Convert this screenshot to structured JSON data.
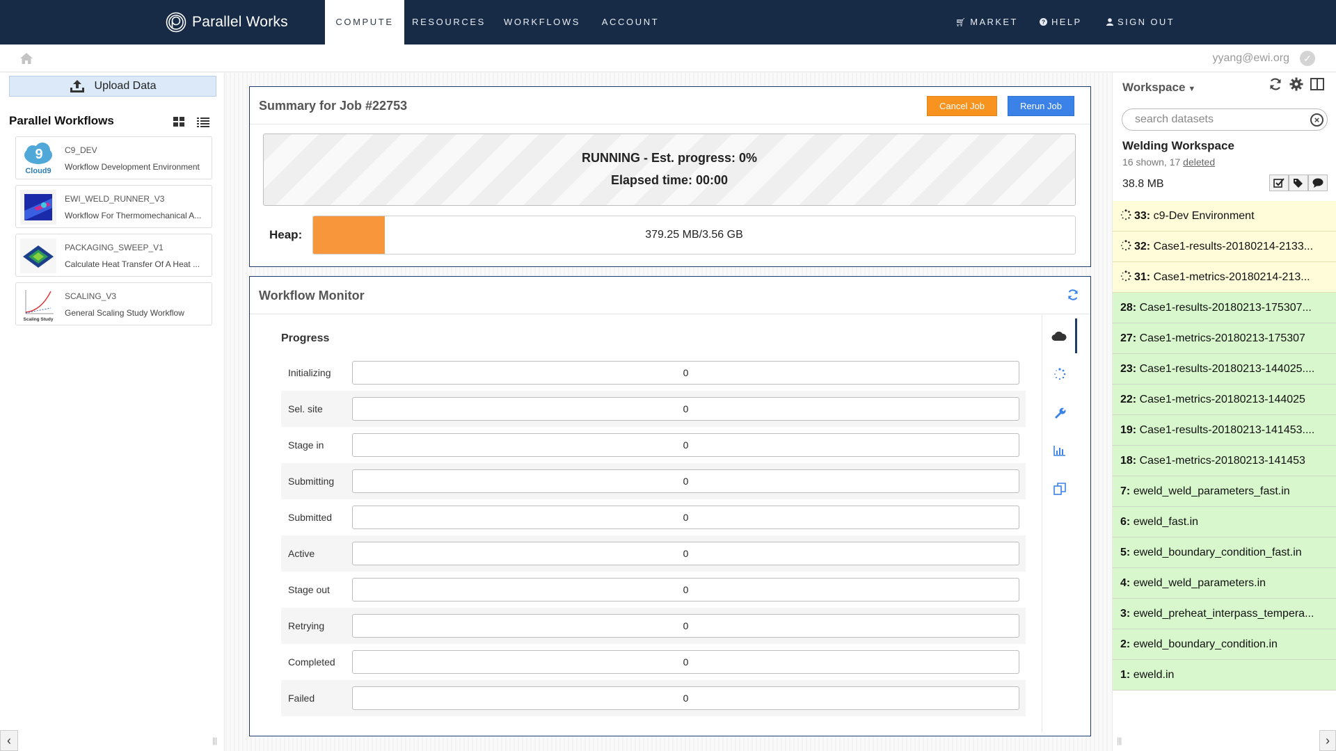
{
  "brand": {
    "name": "Parallel Works"
  },
  "nav": {
    "tabs": [
      {
        "label": "COMPUTE",
        "active": true
      },
      {
        "label": "RESOURCES",
        "active": false
      },
      {
        "label": "WORKFLOWS",
        "active": false
      },
      {
        "label": "ACCOUNT",
        "active": false
      }
    ],
    "right": [
      {
        "label": "MARKET",
        "icon": "cart-icon"
      },
      {
        "label": "HELP",
        "icon": "question-circle-icon"
      },
      {
        "label": "SIGN OUT",
        "icon": "user-icon"
      }
    ]
  },
  "user": {
    "email": "yyang@ewi.org"
  },
  "left": {
    "upload_label": "Upload Data",
    "title": "Parallel Workflows",
    "workflows": [
      {
        "name": "C9_DEV",
        "description": "Workflow Development Environment"
      },
      {
        "name": "EWI_WELD_RUNNER_V3",
        "description": "Workflow For Thermomechanical A..."
      },
      {
        "name": "PACKAGING_SWEEP_V1",
        "description": "Calculate Heat Transfer Of A Heat ..."
      },
      {
        "name": "SCALING_V3",
        "description": "General Scaling Study Workflow"
      }
    ],
    "thumb_texts": {
      "cloud9": "Cloud9",
      "scaling": "Scaling Study"
    }
  },
  "summary": {
    "title": "Summary for Job #22753",
    "cancel_label": "Cancel Job",
    "rerun_label": "Rerun Job",
    "status": "RUNNING - Est. progress: 0%",
    "elapsed": "Elapsed time: 00:00",
    "heap_label": "Heap:",
    "heap_text": "379.25 MB/3.56 GB",
    "heap_fraction": 0.094
  },
  "monitor": {
    "title": "Workflow Monitor",
    "progress_title": "Progress",
    "rows": [
      {
        "label": "Initializing",
        "value": "0"
      },
      {
        "label": "Sel. site",
        "value": "0"
      },
      {
        "label": "Stage in",
        "value": "0"
      },
      {
        "label": "Submitting",
        "value": "0"
      },
      {
        "label": "Submitted",
        "value": "0"
      },
      {
        "label": "Active",
        "value": "0"
      },
      {
        "label": "Stage out",
        "value": "0"
      },
      {
        "label": "Retrying",
        "value": "0"
      },
      {
        "label": "Completed",
        "value": "0"
      },
      {
        "label": "Failed",
        "value": "0"
      }
    ],
    "side_tabs": [
      "cloud-icon",
      "spinner-icon",
      "wrench-icon",
      "bar-chart-icon",
      "copy-icon"
    ]
  },
  "workspace": {
    "title": "Workspace",
    "search_placeholder": "search datasets",
    "name": "Welding Workspace",
    "count_prefix": "16 shown, 17 ",
    "deleted_label": "deleted",
    "size": "38.8 MB",
    "datasets": [
      {
        "id": "33:",
        "name": "c9-Dev Environment",
        "state": "running"
      },
      {
        "id": "32:",
        "name": "Case1-results-20180214-2133...",
        "state": "running"
      },
      {
        "id": "31:",
        "name": "Case1-metrics-20180214-213...",
        "state": "running"
      },
      {
        "id": "28:",
        "name": "Case1-results-20180213-175307...",
        "state": "done"
      },
      {
        "id": "27:",
        "name": "Case1-metrics-20180213-175307",
        "state": "done"
      },
      {
        "id": "23:",
        "name": "Case1-results-20180213-144025....",
        "state": "done"
      },
      {
        "id": "22:",
        "name": "Case1-metrics-20180213-144025",
        "state": "done"
      },
      {
        "id": "19:",
        "name": "Case1-results-20180213-141453....",
        "state": "done"
      },
      {
        "id": "18:",
        "name": "Case1-metrics-20180213-141453",
        "state": "done"
      },
      {
        "id": "7:",
        "name": "eweld_weld_parameters_fast.in",
        "state": "done"
      },
      {
        "id": "6:",
        "name": "eweld_fast.in",
        "state": "done"
      },
      {
        "id": "5:",
        "name": "eweld_boundary_condition_fast.in",
        "state": "done"
      },
      {
        "id": "4:",
        "name": "eweld_weld_parameters.in",
        "state": "done"
      },
      {
        "id": "3:",
        "name": "eweld_preheat_interpass_tempera...",
        "state": "done"
      },
      {
        "id": "2:",
        "name": "eweld_boundary_condition.in",
        "state": "done"
      },
      {
        "id": "1:",
        "name": "eweld.in",
        "state": "done"
      }
    ]
  },
  "colors": {
    "nav_bg": "#172b47",
    "accent_orange": "#f7931e",
    "accent_blue": "#3b82e8",
    "running_bg": "#fffcd9",
    "done_bg": "#d9f7cd"
  }
}
